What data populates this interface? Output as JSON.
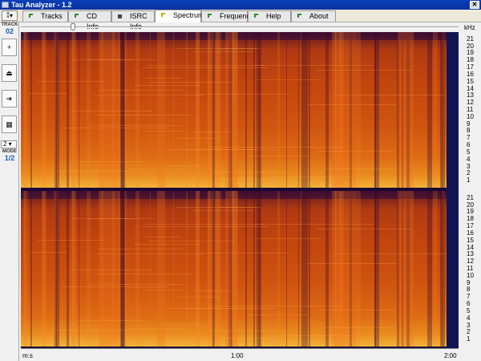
{
  "window": {
    "title": "Tau Analyzer - 1.2"
  },
  "tabs": [
    {
      "label": "Tracks",
      "icon": "green-arrow-icon"
    },
    {
      "label": "CD Info",
      "icon": "green-arrow-icon"
    },
    {
      "label": "ISRC Info",
      "icon": "barcode-icon"
    },
    {
      "label": "Spectrum",
      "icon": "yellow-arrow-icon",
      "active": true
    },
    {
      "label": "Frequency",
      "icon": "green-arrow-icon"
    },
    {
      "label": "Help",
      "icon": "green-arrow-icon"
    },
    {
      "label": "About",
      "icon": "green-arrow-icon"
    }
  ],
  "sidebar": {
    "top_button": "⁑▾",
    "track_label": "TRACK",
    "track_value": "02",
    "buttons": [
      "+",
      "⏏",
      "➔",
      "▦"
    ],
    "mode_select": "2 ▾",
    "mode_label": "MODE",
    "mode_value": "1/2"
  },
  "spectrum": {
    "unit_label": "kHz",
    "ticks_top": [
      "21",
      "20",
      "19",
      "18",
      "17",
      "16",
      "15",
      "14",
      "13",
      "12",
      "11",
      "10",
      "9",
      "8",
      "7",
      "6",
      "5",
      "4",
      "3",
      "2",
      "1"
    ],
    "ticks_bottom": [
      "21",
      "20",
      "19",
      "18",
      "17",
      "16",
      "15",
      "14",
      "13",
      "12",
      "11",
      "10",
      "9",
      "8",
      "7",
      "6",
      "5",
      "4",
      "3",
      "2",
      "1"
    ],
    "colors": {
      "hot": "#f3b23a",
      "mid": "#cf5510",
      "cool": "#5a1226",
      "bg": "#0f1650"
    }
  },
  "timeline": {
    "left_label": "m:s",
    "mid_label": "1:00",
    "end_label": "2:00"
  }
}
